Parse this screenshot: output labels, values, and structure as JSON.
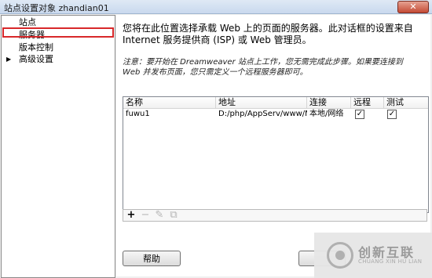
{
  "window": {
    "title": "站点设置对象 zhandian01",
    "close_label": "✕"
  },
  "sidebar": {
    "items": [
      {
        "label": "站点",
        "expandable": false
      },
      {
        "label": "服务器",
        "expandable": false,
        "selected": true
      },
      {
        "label": "版本控制",
        "expandable": false
      },
      {
        "label": "高级设置",
        "expandable": true
      }
    ]
  },
  "main": {
    "description": "您将在此位置选择承载 Web 上的页面的服务器。此对话框的设置来自 Internet 服务提供商 (ISP) 或 Web 管理员。",
    "note": "注意：要开始在 Dreamweaver 站点上工作，您无需完成此步骤。如果要连接到 Web 并发布页面，您只需定义一个远程服务器即可。"
  },
  "server_table": {
    "columns": [
      "名称",
      "地址",
      "连接",
      "远程",
      "测试"
    ],
    "rows": [
      {
        "name": "fuwu1",
        "address": "D:/php/AppServ/www/M...",
        "connection": "本地/网络",
        "remote": true,
        "test": true
      }
    ]
  },
  "toolbar": {
    "add_icon": "+",
    "remove_icon": "−",
    "edit_icon": "✎",
    "duplicate_icon": "⧉"
  },
  "buttons": {
    "help": "帮助"
  },
  "watermark": {
    "name": "创新互联",
    "sub": "CHUANG XIN HU LIAN"
  }
}
